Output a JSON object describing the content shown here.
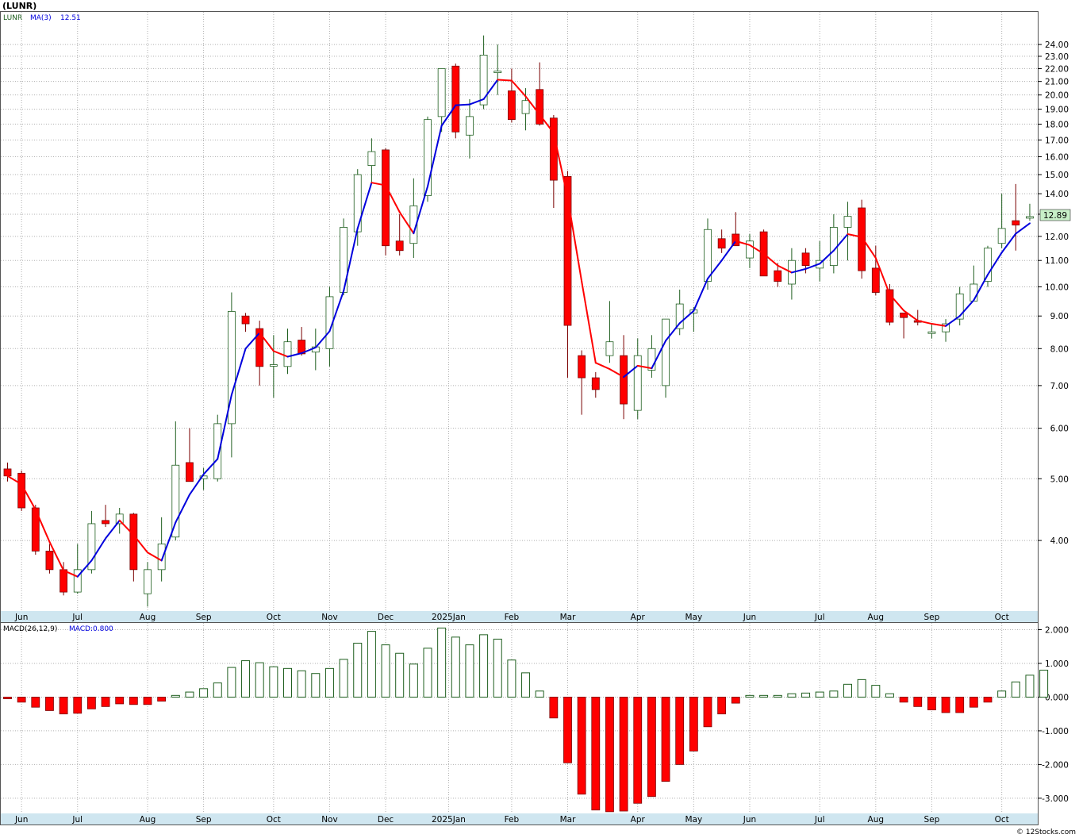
{
  "window": {
    "title": "(LUNR)",
    "footer": "© 12Stocks.com"
  },
  "colors": {
    "up_candle": "#1f5f1f",
    "down_candle": "#ff0000",
    "ma_up": "#0000dd",
    "ma_down": "#ff0000",
    "axis_band": "#cfe6f0",
    "grid": "#aaaaaa",
    "last_price_box": "#c8f0c8"
  },
  "chart_data": [
    {
      "type": "candlestick",
      "title": "(LUNR)",
      "legend": [
        {
          "label": "LUNR",
          "color": "#1f5f1f"
        },
        {
          "label": "MA(3)",
          "color": "#0000dd"
        },
        {
          "label": "12.51",
          "color": "#0000dd"
        }
      ],
      "y_scale": "log",
      "ylim": [
        3.1,
        27.0
      ],
      "y_ticks": [
        4.0,
        5.0,
        6.0,
        7.0,
        8.0,
        9.0,
        10.0,
        11.0,
        12.0,
        13.0,
        14.0,
        15.0,
        16.0,
        17.0,
        18.0,
        19.0,
        20.0,
        21.0,
        22.0,
        23.0,
        24.0
      ],
      "y_tick_labels": [
        "4.00",
        "5.00",
        "6.00",
        "7.00",
        "8.00",
        "9.00",
        "10.00",
        "11.00",
        "12.00",
        "13.00",
        "14.00",
        "15.00",
        "16.00",
        "17.00",
        "18.00",
        "19.00",
        "20.00",
        "21.00",
        "22.00",
        "23.00",
        "24.00"
      ],
      "last_price": "12.89",
      "x_labels": [
        {
          "label": "Jun",
          "week": 1
        },
        {
          "label": "Jul",
          "week": 5
        },
        {
          "label": "Aug",
          "week": 10
        },
        {
          "label": "Sep",
          "week": 14
        },
        {
          "label": "Oct",
          "week": 19
        },
        {
          "label": "Nov",
          "week": 23
        },
        {
          "label": "Dec",
          "week": 27
        },
        {
          "label": "2025Jan",
          "week": 31.5
        },
        {
          "label": "Feb",
          "week": 36
        },
        {
          "label": "Mar",
          "week": 40
        },
        {
          "label": "Apr",
          "week": 45
        },
        {
          "label": "May",
          "week": 49
        },
        {
          "label": "Jun",
          "week": 53
        },
        {
          "label": "Jul",
          "week": 58
        },
        {
          "label": "Aug",
          "week": 62
        },
        {
          "label": "Sep",
          "week": 66
        },
        {
          "label": "Oct",
          "week": 71
        }
      ],
      "candles": [
        {
          "o": 5.18,
          "h": 5.3,
          "l": 4.95,
          "c": 5.05
        },
        {
          "o": 5.1,
          "h": 5.15,
          "l": 4.45,
          "c": 4.5
        },
        {
          "o": 4.5,
          "h": 4.55,
          "l": 3.8,
          "c": 3.85
        },
        {
          "o": 3.85,
          "h": 3.95,
          "l": 3.55,
          "c": 3.6
        },
        {
          "o": 3.6,
          "h": 3.7,
          "l": 3.28,
          "c": 3.32
        },
        {
          "o": 3.32,
          "h": 3.95,
          "l": 3.3,
          "c": 3.6
        },
        {
          "o": 3.6,
          "h": 4.45,
          "l": 3.55,
          "c": 4.25
        },
        {
          "o": 4.3,
          "h": 4.55,
          "l": 4.2,
          "c": 4.25
        },
        {
          "o": 4.25,
          "h": 4.5,
          "l": 4.1,
          "c": 4.4
        },
        {
          "o": 4.4,
          "h": 4.42,
          "l": 3.45,
          "c": 3.6
        },
        {
          "o": 3.3,
          "h": 3.7,
          "l": 3.15,
          "c": 3.6
        },
        {
          "o": 3.6,
          "h": 4.35,
          "l": 3.45,
          "c": 3.95
        },
        {
          "o": 4.05,
          "h": 6.15,
          "l": 4.0,
          "c": 5.25
        },
        {
          "o": 5.3,
          "h": 6.0,
          "l": 5.0,
          "c": 4.95
        },
        {
          "o": 5.0,
          "h": 5.2,
          "l": 4.8,
          "c": 5.05
        },
        {
          "o": 5.0,
          "h": 6.3,
          "l": 4.95,
          "c": 6.1
        },
        {
          "o": 6.1,
          "h": 9.8,
          "l": 5.4,
          "c": 9.15
        },
        {
          "o": 9.0,
          "h": 9.1,
          "l": 8.5,
          "c": 8.75
        },
        {
          "o": 8.6,
          "h": 8.85,
          "l": 7.0,
          "c": 7.5
        },
        {
          "o": 7.55,
          "h": 8.4,
          "l": 6.7,
          "c": 7.55
        },
        {
          "o": 7.5,
          "h": 8.6,
          "l": 7.3,
          "c": 8.2
        },
        {
          "o": 8.25,
          "h": 8.65,
          "l": 7.8,
          "c": 7.85
        },
        {
          "o": 7.9,
          "h": 8.6,
          "l": 7.4,
          "c": 8.05
        },
        {
          "o": 8.0,
          "h": 10.0,
          "l": 7.5,
          "c": 9.65
        },
        {
          "o": 9.8,
          "h": 12.8,
          "l": 9.7,
          "c": 12.4
        },
        {
          "o": 12.2,
          "h": 15.3,
          "l": 11.6,
          "c": 15.0
        },
        {
          "o": 15.5,
          "h": 17.1,
          "l": 14.5,
          "c": 16.3
        },
        {
          "o": 16.4,
          "h": 16.5,
          "l": 11.2,
          "c": 11.6
        },
        {
          "o": 11.8,
          "h": 13.0,
          "l": 11.2,
          "c": 11.4
        },
        {
          "o": 11.7,
          "h": 14.8,
          "l": 11.1,
          "c": 13.4
        },
        {
          "o": 13.9,
          "h": 18.5,
          "l": 13.6,
          "c": 18.3
        },
        {
          "o": 18.5,
          "h": 22.0,
          "l": 17.5,
          "c": 22.0
        },
        {
          "o": 22.2,
          "h": 22.4,
          "l": 17.1,
          "c": 17.5
        },
        {
          "o": 17.3,
          "h": 19.7,
          "l": 15.9,
          "c": 18.5
        },
        {
          "o": 19.3,
          "h": 24.8,
          "l": 19.0,
          "c": 23.1
        },
        {
          "o": 21.8,
          "h": 24.0,
          "l": 20.0,
          "c": 21.8
        },
        {
          "o": 20.3,
          "h": 22.0,
          "l": 18.1,
          "c": 18.3
        },
        {
          "o": 18.7,
          "h": 20.5,
          "l": 17.6,
          "c": 19.6
        },
        {
          "o": 20.4,
          "h": 22.5,
          "l": 17.9,
          "c": 18.0
        },
        {
          "o": 18.4,
          "h": 18.6,
          "l": 13.3,
          "c": 14.7
        },
        {
          "o": 14.9,
          "h": 15.2,
          "l": 7.2,
          "c": 8.7
        },
        {
          "o": 7.8,
          "h": 7.95,
          "l": 6.3,
          "c": 7.2
        },
        {
          "o": 7.2,
          "h": 7.35,
          "l": 6.7,
          "c": 6.9
        },
        {
          "o": 7.8,
          "h": 9.5,
          "l": 7.6,
          "c": 8.2
        },
        {
          "o": 7.8,
          "h": 8.4,
          "l": 6.2,
          "c": 6.55
        },
        {
          "o": 6.4,
          "h": 8.3,
          "l": 6.2,
          "c": 7.8
        },
        {
          "o": 7.4,
          "h": 8.4,
          "l": 7.2,
          "c": 8.0
        },
        {
          "o": 7.0,
          "h": 8.6,
          "l": 6.7,
          "c": 8.9
        },
        {
          "o": 8.6,
          "h": 9.9,
          "l": 8.4,
          "c": 9.4
        },
        {
          "o": 9.1,
          "h": 9.3,
          "l": 8.5,
          "c": 9.2
        },
        {
          "o": 10.2,
          "h": 12.8,
          "l": 9.9,
          "c": 12.3
        },
        {
          "o": 11.9,
          "h": 12.3,
          "l": 11.3,
          "c": 11.5
        },
        {
          "o": 12.1,
          "h": 13.1,
          "l": 11.6,
          "c": 11.6
        },
        {
          "o": 11.1,
          "h": 12.1,
          "l": 10.7,
          "c": 11.8
        },
        {
          "o": 12.2,
          "h": 12.3,
          "l": 10.4,
          "c": 10.4
        },
        {
          "o": 10.6,
          "h": 10.9,
          "l": 10.0,
          "c": 10.2
        },
        {
          "o": 10.1,
          "h": 11.5,
          "l": 9.55,
          "c": 11.0
        },
        {
          "o": 11.3,
          "h": 11.5,
          "l": 10.5,
          "c": 10.8
        },
        {
          "o": 10.7,
          "h": 11.8,
          "l": 10.2,
          "c": 11.0
        },
        {
          "o": 10.8,
          "h": 13.0,
          "l": 10.5,
          "c": 12.4
        },
        {
          "o": 12.4,
          "h": 13.6,
          "l": 11.0,
          "c": 12.9
        },
        {
          "o": 13.3,
          "h": 13.7,
          "l": 10.3,
          "c": 10.6
        },
        {
          "o": 10.7,
          "h": 11.6,
          "l": 9.7,
          "c": 9.8
        },
        {
          "o": 9.9,
          "h": 10.1,
          "l": 8.7,
          "c": 8.8
        },
        {
          "o": 9.1,
          "h": 9.1,
          "l": 8.3,
          "c": 8.95
        },
        {
          "o": 8.85,
          "h": 9.2,
          "l": 8.7,
          "c": 8.8
        },
        {
          "o": 8.45,
          "h": 8.75,
          "l": 8.3,
          "c": 8.5
        },
        {
          "o": 8.5,
          "h": 8.9,
          "l": 8.2,
          "c": 8.75
        },
        {
          "o": 8.9,
          "h": 10.0,
          "l": 8.7,
          "c": 9.75
        },
        {
          "o": 9.5,
          "h": 10.8,
          "l": 9.5,
          "c": 10.1
        },
        {
          "o": 10.2,
          "h": 11.6,
          "l": 10.0,
          "c": 11.5
        },
        {
          "o": 11.7,
          "h": 14.0,
          "l": 11.5,
          "c": 12.35
        },
        {
          "o": 12.7,
          "h": 14.5,
          "l": 11.4,
          "c": 12.5
        },
        {
          "o": 12.85,
          "h": 13.5,
          "l": 12.7,
          "c": 12.89
        }
      ],
      "ma": [
        5.05,
        4.9,
        4.47,
        3.98,
        3.59,
        3.51,
        3.72,
        4.03,
        4.3,
        4.08,
        3.83,
        3.72,
        4.27,
        4.72,
        5.08,
        5.37,
        6.77,
        8.0,
        8.47,
        7.93,
        7.77,
        7.87,
        8.03,
        8.52,
        9.85,
        12.35,
        14.57,
        14.43,
        13.1,
        12.13,
        14.37,
        17.9,
        19.27,
        19.33,
        19.7,
        21.13,
        21.07,
        19.9,
        18.63,
        17.43,
        13.8,
        10.2,
        7.6,
        7.43,
        7.22,
        7.52,
        7.45,
        8.23,
        8.77,
        9.17,
        10.3,
        11.0,
        11.8,
        11.63,
        11.27,
        10.8,
        10.53,
        10.67,
        10.87,
        11.4,
        12.1,
        11.97,
        11.1,
        9.73,
        9.18,
        8.85,
        8.75,
        8.68,
        9.0,
        9.53,
        10.45,
        11.32,
        12.12,
        12.58
      ]
    },
    {
      "type": "bar",
      "title": "MACD(26,12,9)",
      "legend": [
        {
          "label": "MACD(26,12,9)",
          "color": "#000000"
        },
        {
          "label": "MACD:0.800",
          "color": "#0000dd"
        }
      ],
      "ylim": [
        -3.45,
        2.2
      ],
      "y_ticks": [
        -3.0,
        -2.0,
        -1.0,
        0.0,
        1.0,
        2.0
      ],
      "y_tick_labels": [
        "-3.000",
        "-2.000",
        "-1.000",
        "0.000",
        "1.000",
        "2.000"
      ],
      "values": [
        -0.05,
        -0.15,
        -0.3,
        -0.4,
        -0.5,
        -0.48,
        -0.35,
        -0.28,
        -0.2,
        -0.22,
        -0.22,
        -0.12,
        0.05,
        0.15,
        0.25,
        0.42,
        0.88,
        1.08,
        1.02,
        0.9,
        0.85,
        0.78,
        0.7,
        0.85,
        1.12,
        1.6,
        1.95,
        1.55,
        1.3,
        0.98,
        1.45,
        2.05,
        1.78,
        1.55,
        1.85,
        1.72,
        1.1,
        0.72,
        0.18,
        -0.62,
        -1.95,
        -2.88,
        -3.35,
        -3.4,
        -3.38,
        -3.15,
        -2.95,
        -2.5,
        -2.0,
        -1.6,
        -0.88,
        -0.5,
        -0.18,
        0.05,
        0.05,
        0.05,
        0.1,
        0.12,
        0.15,
        0.18,
        0.38,
        0.52,
        0.35,
        0.1,
        -0.15,
        -0.28,
        -0.38,
        -0.46,
        -0.46,
        -0.3,
        -0.15,
        0.18,
        0.45,
        0.65,
        0.8
      ]
    }
  ],
  "x_axis_labels": [
    "Jun",
    "Jul",
    "Aug",
    "Sep",
    "Oct",
    "Nov",
    "Dec",
    "2025Jan",
    "Feb",
    "Mar",
    "Apr",
    "May",
    "Jun",
    "Jul",
    "Aug",
    "Sep",
    "Oct"
  ]
}
